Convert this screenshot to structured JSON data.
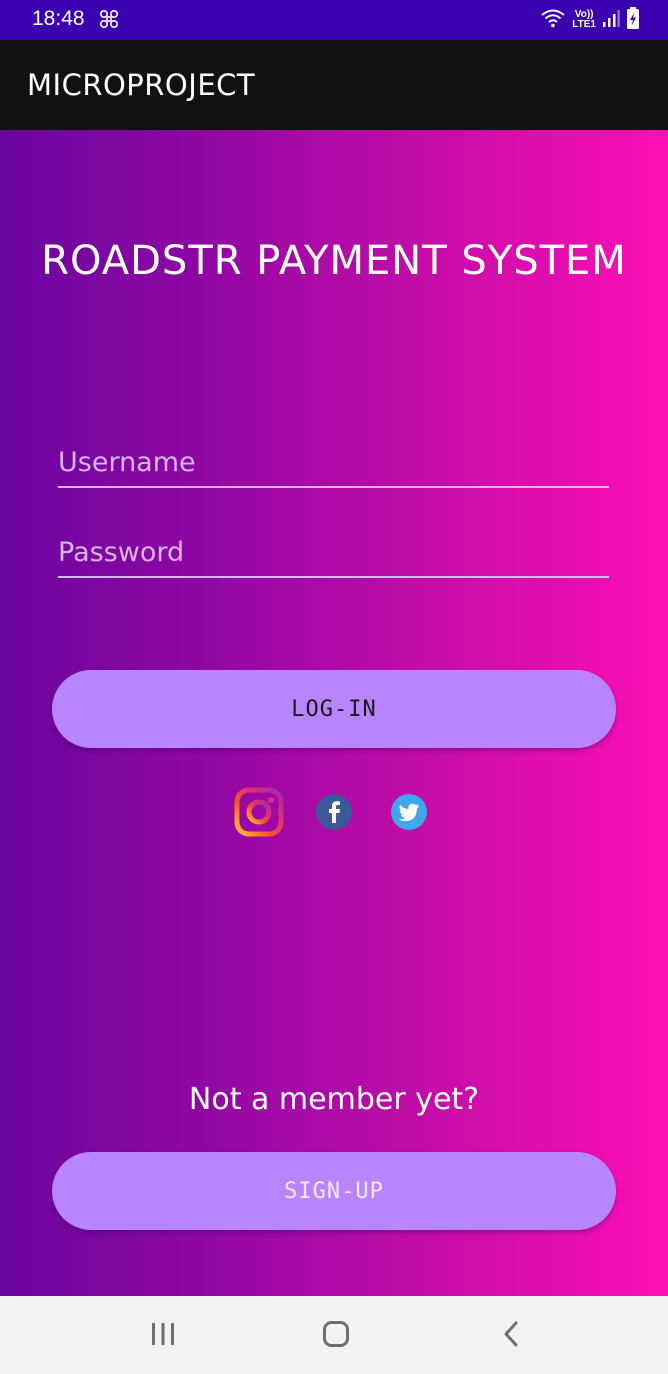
{
  "status_bar": {
    "time": "18:48",
    "volte_top": "Vo))",
    "volte_bottom": "LTE1"
  },
  "app_bar": {
    "title": "MICROPROJECT"
  },
  "main": {
    "title": "ROADSTR PAYMENT SYSTEM",
    "username_placeholder": "Username",
    "password_placeholder": "Password",
    "login_label": "LOG-IN",
    "social_icons": [
      "instagram-icon",
      "facebook-icon",
      "twitter-icon"
    ],
    "member_prompt": "Not a member yet?",
    "signup_label": "SIGN-UP"
  },
  "colors": {
    "status_bar": "#3a00b0",
    "app_bar": "#111111",
    "gradient_start": "#6a049f",
    "gradient_end": "#fd0fb4",
    "button": "#b985fd"
  }
}
